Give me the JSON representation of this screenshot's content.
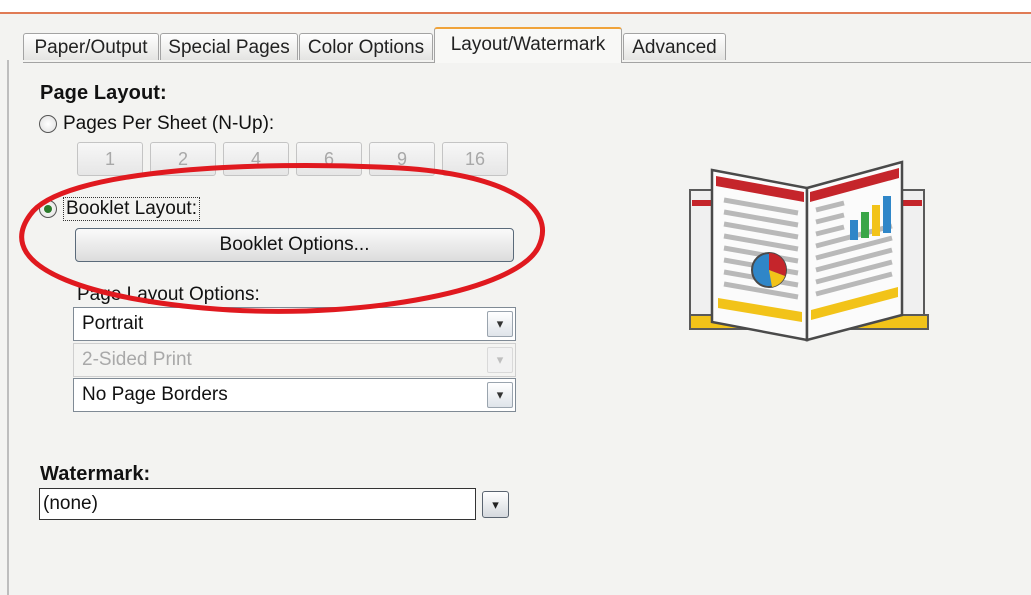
{
  "tabs": [
    {
      "label": "Paper/Output"
    },
    {
      "label": "Special Pages"
    },
    {
      "label": "Color Options"
    },
    {
      "label": "Layout/Watermark"
    },
    {
      "label": "Advanced"
    }
  ],
  "page_layout": {
    "title": "Page Layout",
    "title_colon": ":",
    "pages_per_sheet_label": "Pages Per Sheet (N-Up):",
    "nup_options": [
      "1",
      "2",
      "4",
      "6",
      "9",
      "16"
    ],
    "booklet_label": "Booklet Layout:",
    "booklet_options_label": "Booklet Options...",
    "layout_options_label": "Page Layout Options:",
    "orientation_value": "Portrait",
    "sided_value": "2-Sided Print",
    "borders_value": "No Page Borders"
  },
  "watermark": {
    "title": "Watermark",
    "title_colon": ":",
    "value": "(none)"
  },
  "icons": {
    "dropdown": "▾",
    "booklet_illustration": "booklet-icon"
  },
  "colors": {
    "annotation": "#e0191f",
    "active_tab_accent": "#f0a33a"
  }
}
